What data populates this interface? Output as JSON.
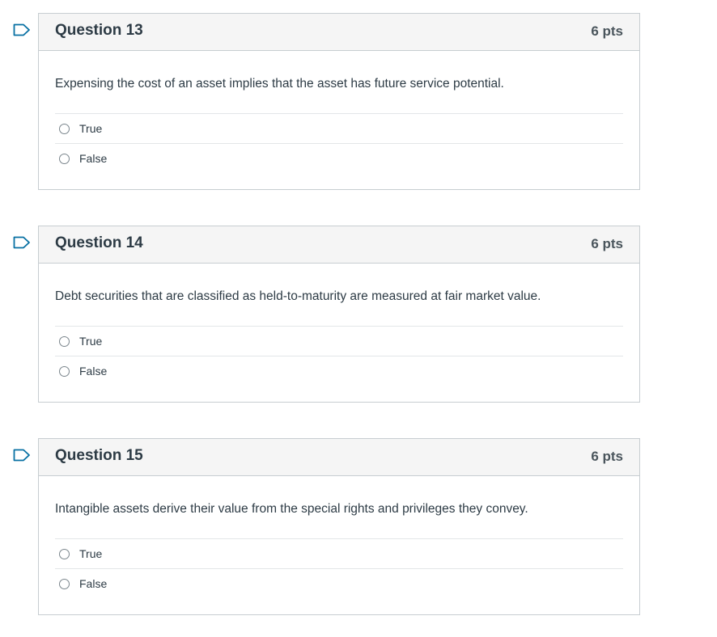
{
  "questions": [
    {
      "title": "Question 13",
      "points": "6 pts",
      "text": "Expensing the cost of an asset implies that the asset has future service potential.",
      "answers": [
        "True",
        "False"
      ]
    },
    {
      "title": "Question 14",
      "points": "6 pts",
      "text": "Debt securities that are classified as held-to-maturity are measured at fair market value.",
      "answers": [
        "True",
        "False"
      ]
    },
    {
      "title": "Question 15",
      "points": "6 pts",
      "text": "Intangible assets derive their value from the special rights and privileges they convey.",
      "answers": [
        "True",
        "False"
      ]
    }
  ],
  "colors": {
    "flag": "#0770a3",
    "border": "#c7cdd1",
    "header_bg": "#f5f5f5"
  },
  "icons": {
    "flag": "flag-question-icon",
    "radio": "radio-button"
  }
}
